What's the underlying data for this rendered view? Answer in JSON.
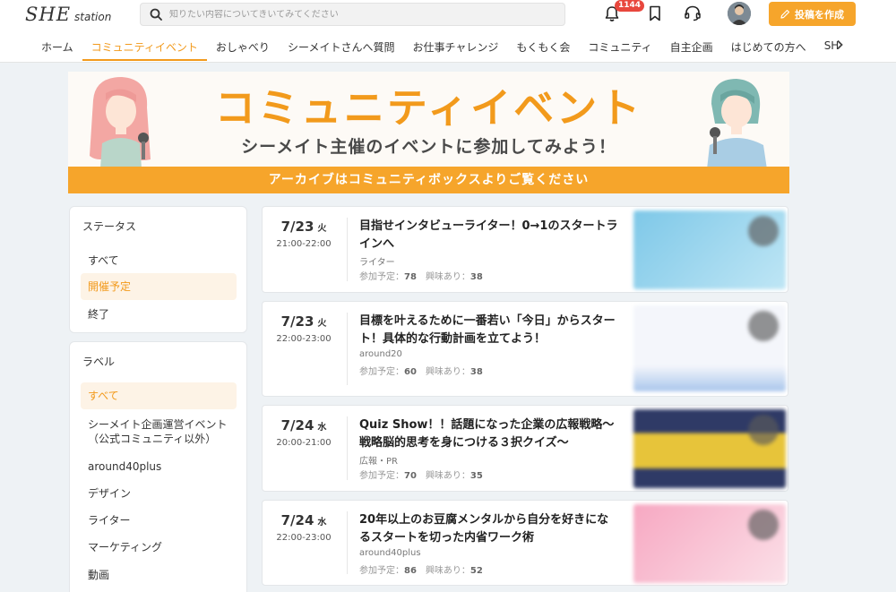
{
  "header": {
    "logo_main": "SHE",
    "logo_sub": "station",
    "search_placeholder": "知りたい内容についてきいてみてください",
    "notification_count": "1144",
    "post_button": "投稿を作成"
  },
  "nav": {
    "tabs": [
      {
        "label": "ホーム"
      },
      {
        "label": "コミュニティイベント"
      },
      {
        "label": "おしゃべり"
      },
      {
        "label": "シーメイトさんへ質問"
      },
      {
        "label": "お仕事チャレンジ"
      },
      {
        "label": "もくもく会"
      },
      {
        "label": "コミュニティ"
      },
      {
        "label": "自主企画"
      },
      {
        "label": "はじめての方へ"
      },
      {
        "label": "SH"
      }
    ],
    "more_icon": "chevron-right-icon"
  },
  "banner": {
    "title": "コミュニティイベント",
    "subtitle": "シーメイト主催のイベントに参加してみよう！",
    "strip": "アーカイブはコミュニティボックスよりご覧ください"
  },
  "sidebar": {
    "status": {
      "heading": "ステータス",
      "items": [
        {
          "label": "すべて"
        },
        {
          "label": "開催予定"
        },
        {
          "label": "終了"
        }
      ]
    },
    "labels": {
      "heading": "ラベル",
      "items": [
        {
          "label": "すべて"
        },
        {
          "label": "シーメイト企画運営イベント（公式コミュニティ以外）"
        },
        {
          "label": "around40plus"
        },
        {
          "label": "デザイン"
        },
        {
          "label": "ライター"
        },
        {
          "label": "マーケティング"
        },
        {
          "label": "動画"
        }
      ]
    }
  },
  "events": [
    {
      "date": "7/23",
      "dow": "火",
      "time": "21:00-22:00",
      "title": "目指せインタビューライター！0→1のスタートラインへ",
      "label": "ライター",
      "join_label": "参加予定：",
      "join": "78",
      "interest_label": "興味あり：",
      "interest": "38",
      "thumb_colors": [
        "#7ec8e8",
        "#bfe6f5"
      ]
    },
    {
      "date": "7/23",
      "dow": "火",
      "time": "22:00-23:00",
      "title": "目標を叶えるために一番若い「今日」からスタート！具体的な行動計画を立てよう！",
      "label": "around20",
      "join_label": "参加予定：",
      "join": "60",
      "interest_label": "興味あり：",
      "interest": "38",
      "thumb_colors": [
        "#f4f6fb",
        "#a9c6ec"
      ]
    },
    {
      "date": "7/24",
      "dow": "水",
      "time": "20:00-21:00",
      "title": "Quiz Show！！話題になった企業の広報戦略〜戦略脳的思考を身につける３択クイズ〜",
      "label": "広報・PR",
      "join_label": "参加予定：",
      "join": "70",
      "interest_label": "興味あり：",
      "interest": "35",
      "thumb_colors": [
        "#2f3a66",
        "#e7c43a"
      ]
    },
    {
      "date": "7/24",
      "dow": "水",
      "time": "22:00-23:00",
      "title": "20年以上のお豆腐メンタルから自分を好きになるスタートを切った内省ワーク術",
      "label": "around40plus",
      "join_label": "参加予定：",
      "join": "86",
      "interest_label": "興味あり：",
      "interest": "52",
      "thumb_colors": [
        "#f7a8c2",
        "#fbe0e8"
      ]
    }
  ]
}
